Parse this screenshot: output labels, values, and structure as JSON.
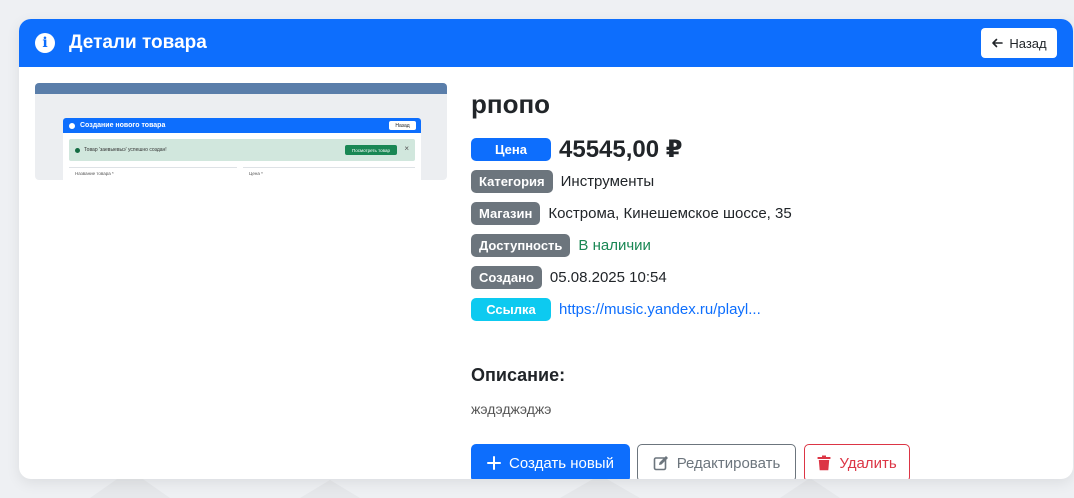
{
  "header": {
    "title": "Детали товара",
    "back_label": "Назад"
  },
  "preview": {
    "title": "Создание нового товара",
    "back_label": "Назад",
    "alert_text": "Товар 'заевыевыэ' успешно создан!",
    "alert_button": "Посмотреть товар",
    "field1_label": "Название товара *",
    "field2_label": "Цена *"
  },
  "product": {
    "name": "рпопо",
    "price_label": "Цена",
    "price": "45545,00 ₽",
    "category_label": "Категория",
    "category": "Инструменты",
    "store_label": "Магазин",
    "store": "Кострома, Кинешемское шоссе, 35",
    "availability_label": "Доступность",
    "availability": "В наличии",
    "created_label": "Создано",
    "created": "05.08.2025 10:54",
    "link_label": "Ссылка",
    "link": "https://music.yandex.ru/playl..."
  },
  "description": {
    "title": "Описание:",
    "text": "жэдэджэджэ"
  },
  "actions": {
    "create_label": "Создать новый",
    "edit_label": "Редактировать",
    "delete_label": "Удалить"
  },
  "colors": {
    "primary": "#0d6efd",
    "secondary": "#6c757d",
    "success": "#198754",
    "danger": "#dc3545",
    "info": "#0dcaf0"
  }
}
